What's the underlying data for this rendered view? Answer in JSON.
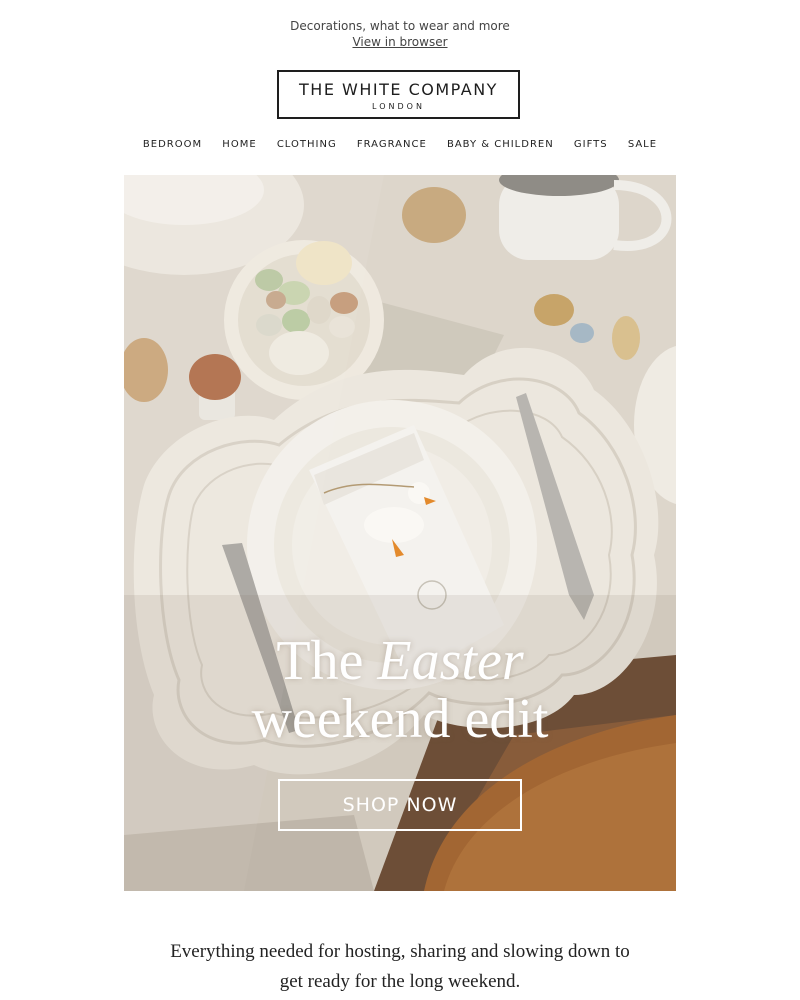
{
  "preheader": {
    "text": "Decorations, what to wear and more",
    "view_link": "View in browser"
  },
  "logo": {
    "brand": "THE WHITE COMPANY",
    "city": "LONDON"
  },
  "nav": {
    "items": [
      "BEDROOM",
      "HOME",
      "CLOTHING",
      "FRAGRANCE",
      "BABY & CHILDREN",
      "GIFTS",
      "SALE"
    ]
  },
  "hero": {
    "title_pre": "The",
    "title_em": "Easter",
    "title_line2": "weekend edit",
    "cta_label": "SHOP NOW"
  },
  "intro": {
    "text": "Everything needed for hosting, sharing and slowing down to get ready for the long weekend."
  }
}
